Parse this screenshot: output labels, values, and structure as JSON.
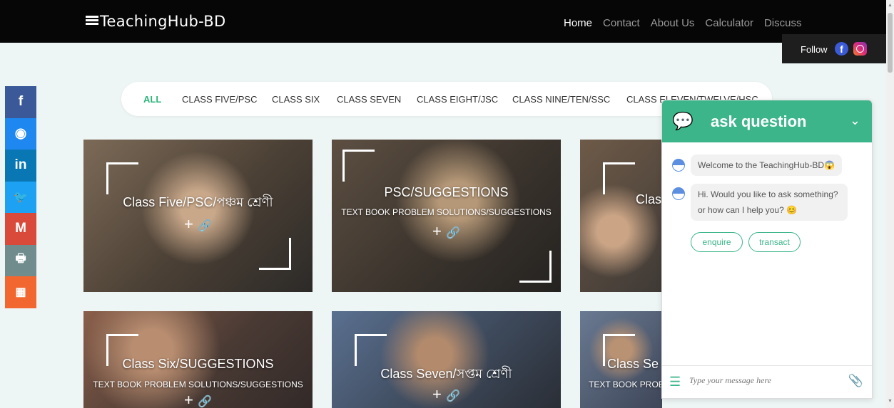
{
  "header": {
    "logo": "TeachingHub-BD",
    "nav": [
      {
        "label": "Home",
        "active": true
      },
      {
        "label": "Contact",
        "active": false
      },
      {
        "label": "About Us",
        "active": false
      },
      {
        "label": "Calculator",
        "active": false
      },
      {
        "label": "Discuss",
        "active": false
      }
    ],
    "follow_label": "Follow",
    "facebook_glyph": "f"
  },
  "filters": [
    {
      "label": "ALL",
      "active": true
    },
    {
      "label": "CLASS FIVE/PSC",
      "active": false
    },
    {
      "label": "CLASS SIX",
      "active": false
    },
    {
      "label": "CLASS SEVEN",
      "active": false
    },
    {
      "label": "CLASS EIGHT/JSC",
      "active": false
    },
    {
      "label": "CLASS NINE/TEN/SSC",
      "active": false
    },
    {
      "label": "CLASS ELEVEN/TWELVE/HSC",
      "active": false
    }
  ],
  "social": [
    {
      "name": "facebook-icon",
      "glyph": "f",
      "color": "#3b5998"
    },
    {
      "name": "messenger-icon",
      "glyph": "◉",
      "color": "#1e88f0"
    },
    {
      "name": "linkedin-icon",
      "glyph": "in",
      "color": "#0a77b5"
    },
    {
      "name": "twitter-icon",
      "glyph": "🐦",
      "color": "#1da1f2"
    },
    {
      "name": "gmail-icon",
      "glyph": "M",
      "color": "#d94a3a"
    },
    {
      "name": "print-icon",
      "glyph": "🖶",
      "color": "#708c8c"
    },
    {
      "name": "qr-code-icon",
      "glyph": "▦",
      "color": "#f2662f"
    }
  ],
  "cards": [
    {
      "title": "Class Five/PSC/পঞ্চম শ্রেণী",
      "subtitle": ""
    },
    {
      "title": "PSC/SUGGESTIONS",
      "subtitle": "TEXT BOOK PROBLEM SOLUTIONS/SUGGESTIONS"
    },
    {
      "title": "Clas",
      "subtitle": ""
    },
    {
      "title": "Class Six/SUGGESTIONS",
      "subtitle": "TEXT BOOK PROBLEM SOLUTIONS/SUGGESTIONS"
    },
    {
      "title": "Class Seven/সপ্তম শ্রেণী",
      "subtitle": ""
    },
    {
      "title": "Class Se",
      "subtitle": "TEXT BOOK PROB"
    }
  ],
  "card_actions": {
    "plus": "+",
    "link": "🔗"
  },
  "chat": {
    "title": "ask question",
    "toggle": "⌄",
    "messages": [
      "Welcome to the TeachingHub-BD😱",
      "Hi. Would you like to ask something? or how can I help you? 😊"
    ],
    "chips": [
      "enquire",
      "transact"
    ],
    "input_placeholder": "Type your message here"
  },
  "colors": {
    "accent": "#3cb58a",
    "topbar": "#060606",
    "page_bg": "#eef5f5"
  }
}
